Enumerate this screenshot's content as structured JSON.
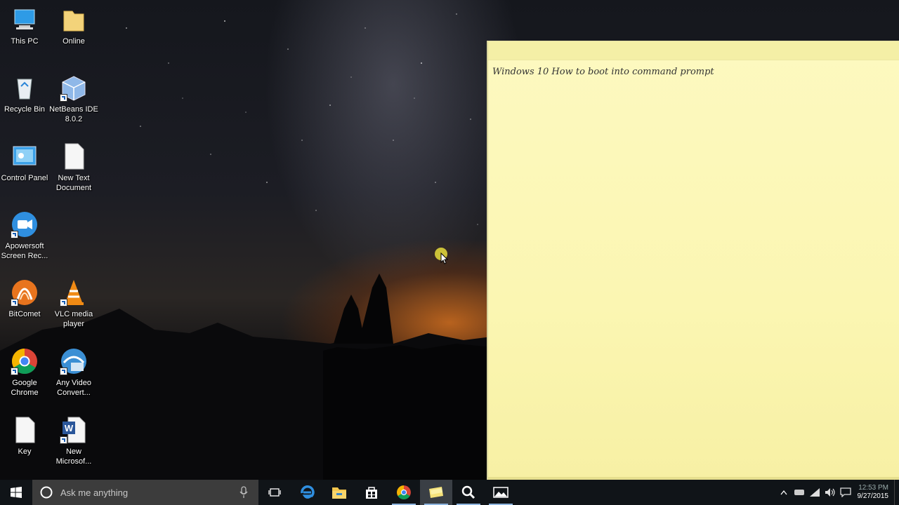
{
  "desktop_icons": [
    {
      "label": "This PC",
      "icon": "this-pc-icon"
    },
    {
      "label": "Online",
      "icon": "folder-icon"
    },
    {
      "label": "Recycle Bin",
      "icon": "recycle-bin-icon"
    },
    {
      "label": "NetBeans IDE 8.0.2",
      "icon": "netbeans-icon"
    },
    {
      "label": "Control Panel",
      "icon": "control-panel-icon"
    },
    {
      "label": "New Text Document",
      "icon": "text-document-icon"
    },
    {
      "label": "Apowersoft Screen Rec...",
      "icon": "apowersoft-icon"
    },
    {
      "label": "BitComet",
      "icon": "bitcomet-icon"
    },
    {
      "label": "VLC media player",
      "icon": "vlc-icon"
    },
    {
      "label": "Google Chrome",
      "icon": "chrome-icon"
    },
    {
      "label": "Any Video Convert...",
      "icon": "video-converter-icon"
    },
    {
      "label": "Key",
      "icon": "blank-document-icon"
    },
    {
      "label": "New Microsof...",
      "icon": "word-document-icon"
    }
  ],
  "sticky_note": {
    "text": "Windows 10 How to boot into command prompt",
    "color": "#fbf6b2"
  },
  "taskbar": {
    "search_placeholder": "Ask me anything",
    "apps": [
      "start-icon",
      "task-view-icon",
      "edge-icon",
      "file-explorer-icon",
      "store-icon",
      "chrome-icon",
      "sticky-notes-icon",
      "search-tool-icon",
      "photos-icon"
    ],
    "active_app": "sticky-notes-icon",
    "clock_time": "12:53 PM",
    "clock_date": "9/27/2015"
  }
}
